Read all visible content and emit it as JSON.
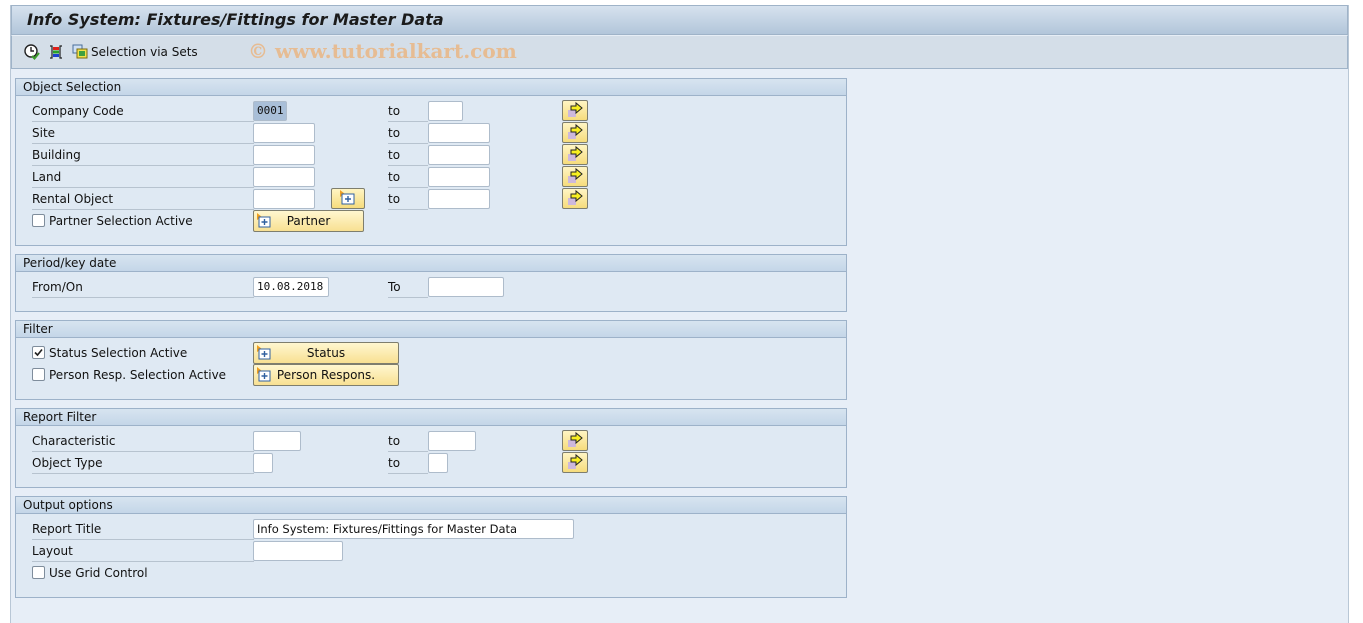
{
  "window": {
    "title": "Info System: Fixtures/Fittings for Master Data"
  },
  "toolbar": {
    "execute_icon": "execute-clock-icon",
    "variants_icon": "get-variant-icon",
    "selection_sets_icon": "selection-sets-icon",
    "selection_sets_label": "Selection via Sets",
    "watermark": "© www.tutorialkart.com"
  },
  "object_selection": {
    "title": "Object Selection",
    "rows": [
      {
        "label": "Company Code",
        "from": "0001",
        "to_label": "to",
        "to": ""
      },
      {
        "label": "Site",
        "from": "",
        "to_label": "to",
        "to": ""
      },
      {
        "label": "Building",
        "from": "",
        "to_label": "to",
        "to": ""
      },
      {
        "label": "Land",
        "from": "",
        "to_label": "to",
        "to": ""
      },
      {
        "label": "Rental Object",
        "from": "",
        "to_label": "to",
        "to": ""
      }
    ],
    "partner_checkbox_label": "Partner Selection Active",
    "partner_checked": false,
    "partner_button": "Partner"
  },
  "period": {
    "title": "Period/key date",
    "from_label": "From/On",
    "from_value": "10.08.2018",
    "to_label": "To",
    "to_value": ""
  },
  "filter": {
    "title": "Filter",
    "status_checkbox_label": "Status Selection Active",
    "status_checked": true,
    "status_button": "Status",
    "person_checkbox_label": "Person Resp. Selection Active",
    "person_checked": false,
    "person_button": "Person Respons."
  },
  "report_filter": {
    "title": "Report Filter",
    "rows": [
      {
        "label": "Characteristic",
        "from": "",
        "to_label": "to",
        "to": ""
      },
      {
        "label": "Object Type",
        "from": "",
        "to_label": "to",
        "to": ""
      }
    ]
  },
  "output_options": {
    "title": "Output options",
    "report_title_label": "Report Title",
    "report_title_value": "Info System: Fixtures/Fittings for Master Data",
    "layout_label": "Layout",
    "layout_value": "",
    "grid_checkbox_label": "Use Grid Control",
    "grid_checked": false
  },
  "colors": {
    "background": "#e7eef7",
    "group_header": "#c4d6e8",
    "button_yellow": "#f6dc7c",
    "watermark": "#e9b98a"
  }
}
